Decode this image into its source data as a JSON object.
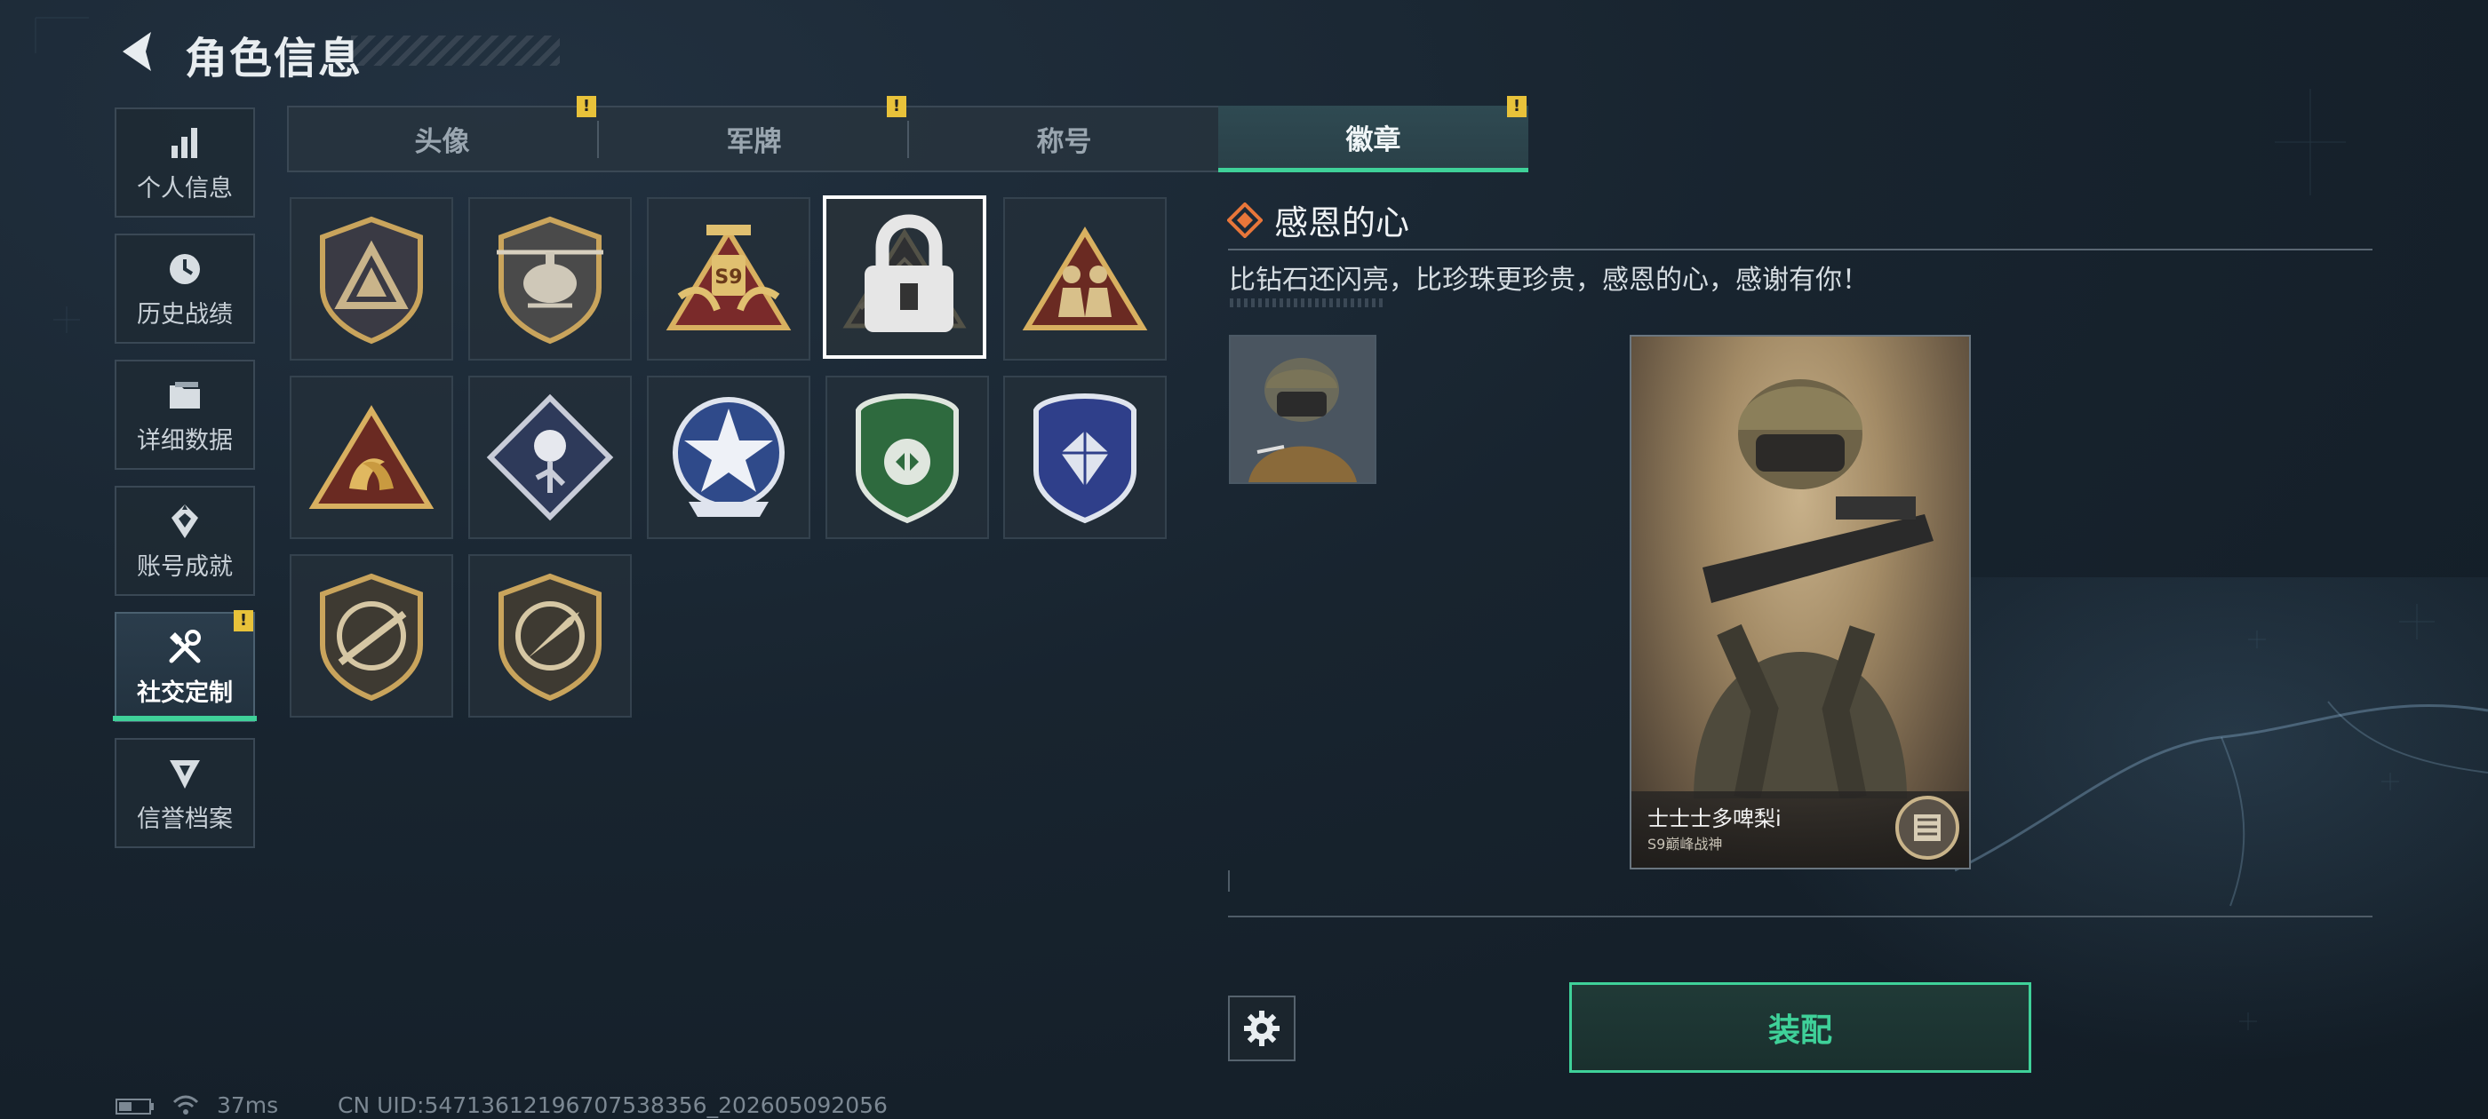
{
  "header": {
    "title": "角色信息"
  },
  "sidebar": {
    "items": [
      {
        "label": "个人信息",
        "icon": "bar-chart-icon",
        "active": false,
        "alert": false
      },
      {
        "label": "历史战绩",
        "icon": "clock-icon",
        "active": false,
        "alert": false
      },
      {
        "label": "详细数据",
        "icon": "folder-icon",
        "active": false,
        "alert": false
      },
      {
        "label": "账号成就",
        "icon": "achievement-icon",
        "active": false,
        "alert": false
      },
      {
        "label": "社交定制",
        "icon": "tools-icon",
        "active": true,
        "alert": true
      },
      {
        "label": "信誉档案",
        "icon": "shield-arrow-icon",
        "active": false,
        "alert": false
      }
    ],
    "alert_mark": "!"
  },
  "tabs": [
    {
      "label": "头像",
      "alert": true,
      "active": false
    },
    {
      "label": "军牌",
      "alert": true,
      "active": false
    },
    {
      "label": "称号",
      "alert": false,
      "active": false
    },
    {
      "label": "徽章",
      "alert": true,
      "active": true
    }
  ],
  "badges": [
    {
      "name": "triangle-shield-badge",
      "locked": false,
      "selected": false
    },
    {
      "name": "helicopter-shield-badge",
      "locked": false,
      "selected": false
    },
    {
      "name": "s9-winged-triangle-badge",
      "locked": false,
      "selected": false
    },
    {
      "name": "hands-gem-triangle-badge",
      "locked": true,
      "selected": true
    },
    {
      "name": "soldiers-triangle-badge",
      "locked": false,
      "selected": false
    },
    {
      "name": "koi-fish-triangle-badge",
      "locked": false,
      "selected": false
    },
    {
      "name": "rose-diamond-badge",
      "locked": false,
      "selected": false
    },
    {
      "name": "star-round-badge",
      "locked": false,
      "selected": false
    },
    {
      "name": "green-shield-badge",
      "locked": false,
      "selected": false
    },
    {
      "name": "blue-gem-shield-badge",
      "locked": false,
      "selected": false
    },
    {
      "name": "rifle-shield-badge",
      "locked": false,
      "selected": false
    },
    {
      "name": "knife-shield-badge",
      "locked": false,
      "selected": false
    }
  ],
  "detail": {
    "title": "感恩的心",
    "description": "比钻石还闪亮，比珍珠更珍贵，感恩的心，感谢有你！",
    "card_name": "士士士多啤梨i",
    "card_subtitle": "S9巅峰战神"
  },
  "actions": {
    "equip_label": "装配"
  },
  "status": {
    "ping": "37ms",
    "uid": "CN UID:5471361219670753835­6_202605092056"
  },
  "colors": {
    "accent": "#3fd199",
    "alert": "#e8c23a",
    "gold": "#c9a45c"
  }
}
